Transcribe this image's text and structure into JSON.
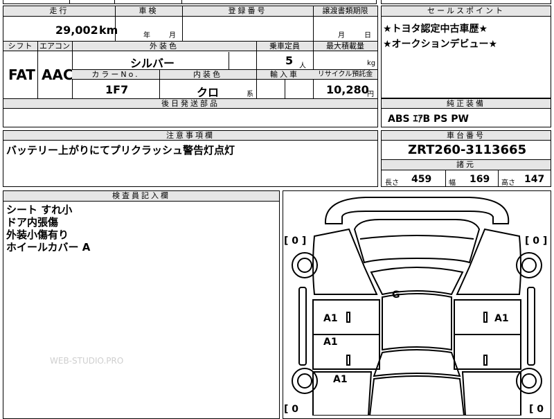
{
  "top_partial": "四号 外",
  "main_table": {
    "mileage_label": "走行",
    "mileage_value": "29,002",
    "mileage_unit": "km",
    "inspection_label": "車検",
    "inspection_year_unit": "年",
    "inspection_month_unit": "月",
    "registration_label": "登録番号",
    "transfer_deadline_label": "譲渡書類期限",
    "transfer_month_unit": "月",
    "transfer_day_unit": "日",
    "shift_label": "シフト",
    "shift_value": "FAT",
    "aircon_label": "エアコン",
    "aircon_value": "AAC",
    "ext_color_label": "外装色",
    "ext_color_value": "シルバー",
    "capacity_label": "乗車定員",
    "capacity_value": "5",
    "capacity_unit": "人",
    "max_load_label": "最大積載量",
    "max_load_unit": "kg",
    "color_no_label": "カラーNo.",
    "color_no_value": "1F7",
    "int_color_label": "内装色",
    "int_color_value": "クロ",
    "int_color_suffix": "系",
    "import_label": "輸入車",
    "recycle_label": "リサイクル預託金",
    "recycle_value": "10,280",
    "recycle_unit": "円",
    "later_parts_label": "後日発送部品"
  },
  "sales_points": {
    "label": "セールスポイント",
    "lines": [
      "★トヨタ認定中古車歴★",
      "★オークションデビュー★"
    ]
  },
  "genuine_equipment": {
    "label": "純正装備",
    "value": "ABS ｴｱB PS PW"
  },
  "notes": {
    "label": "注意事項欄",
    "value": "バッテリー上がりにてプリクラッシュ警告灯点灯"
  },
  "chassis": {
    "label": "車台番号",
    "value": "ZRT260-3113665",
    "dims_label": "諸元",
    "length_label": "長さ",
    "length_value": "459",
    "width_label": "幅",
    "width_value": "169",
    "height_label": "高さ",
    "height_value": "147"
  },
  "inspector": {
    "label": "検査員記入欄",
    "lines": [
      "シート すれ小",
      "ドア内張傷",
      "外装小傷有り",
      "ホイールカバー A"
    ]
  },
  "diagram": {
    "tire_left_top": "[ 0 ]",
    "tire_right_top": "[ 0 ]",
    "tire_left_bottom": "[ 0",
    "tire_right_bottom": "[ 0",
    "mark_roof": "G",
    "mark_left_front_door": "A1",
    "mark_right_front_door": "A1",
    "mark_left_rear_door": "A1",
    "mark_left_rear_fender": "A1"
  },
  "watermark": "WEB-STUDIO.PRO"
}
